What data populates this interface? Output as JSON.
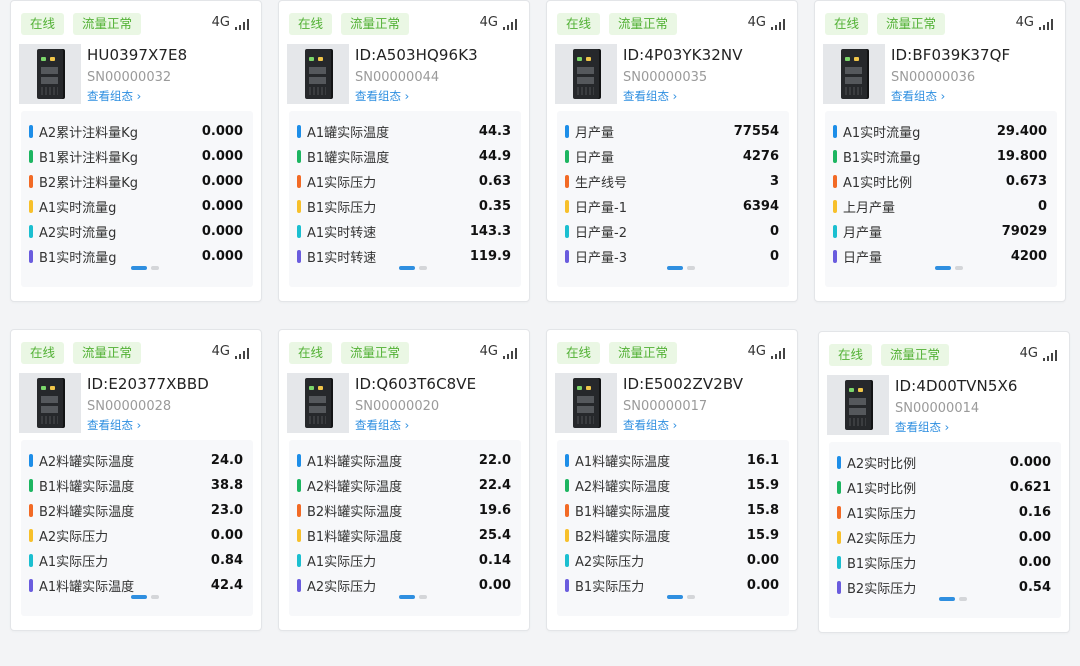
{
  "colors": {
    "bar_blue": "#1d8ee8",
    "bar_green": "#1db561",
    "bar_orange": "#f26a25",
    "bar_yellow": "#f7c02b",
    "bar_cyan": "#1bbfd0",
    "bar_purple": "#6a5cde",
    "tag_bg": "#eaf7e4",
    "tag_text": "#52b135",
    "link": "#2f8fe0"
  },
  "cards": [
    {
      "status": "在线",
      "flow": "流量正常",
      "network": "4G",
      "device_id": "HU0397X7E8",
      "serial": "SN00000032",
      "view_link": "查看组态 ›",
      "metrics": [
        {
          "label": "A2累计注料量Kg",
          "value": "0.000"
        },
        {
          "label": "B1累计注料量Kg",
          "value": "0.000"
        },
        {
          "label": "B2累计注料量Kg",
          "value": "0.000"
        },
        {
          "label": "A1实时流量g",
          "value": "0.000"
        },
        {
          "label": "A2实时流量g",
          "value": "0.000"
        },
        {
          "label": "B1实时流量g",
          "value": "0.000"
        }
      ]
    },
    {
      "status": "在线",
      "flow": "流量正常",
      "network": "4G",
      "device_id": "ID:A503HQ96K3",
      "serial": "SN00000044",
      "view_link": "查看组态 ›",
      "metrics": [
        {
          "label": "A1罐实际温度",
          "value": "44.3"
        },
        {
          "label": "B1罐实际温度",
          "value": "44.9"
        },
        {
          "label": "A1实际压力",
          "value": "0.63"
        },
        {
          "label": "B1实际压力",
          "value": "0.35"
        },
        {
          "label": "A1实时转速",
          "value": "143.3"
        },
        {
          "label": "B1实时转速",
          "value": "119.9"
        }
      ]
    },
    {
      "status": "在线",
      "flow": "流量正常",
      "network": "4G",
      "device_id": "ID:4P03YK32NV",
      "serial": "SN00000035",
      "view_link": "查看组态 ›",
      "metrics": [
        {
          "label": "月产量",
          "value": "77554"
        },
        {
          "label": "日产量",
          "value": "4276"
        },
        {
          "label": "生产线号",
          "value": "3"
        },
        {
          "label": "日产量-1",
          "value": "6394"
        },
        {
          "label": "日产量-2",
          "value": "0"
        },
        {
          "label": "日产量-3",
          "value": "0"
        }
      ]
    },
    {
      "status": "在线",
      "flow": "流量正常",
      "network": "4G",
      "device_id": "ID:BF039K37QF",
      "serial": "SN00000036",
      "view_link": "查看组态 ›",
      "metrics": [
        {
          "label": "A1实时流量g",
          "value": "29.400"
        },
        {
          "label": "B1实时流量g",
          "value": "19.800"
        },
        {
          "label": "A1实时比例",
          "value": "0.673"
        },
        {
          "label": "上月产量",
          "value": "0"
        },
        {
          "label": "月产量",
          "value": "79029"
        },
        {
          "label": "日产量",
          "value": "4200"
        }
      ]
    },
    {
      "status": "在线",
      "flow": "流量正常",
      "network": "4G",
      "device_id": "ID:E20377XBBD",
      "serial": "SN00000028",
      "view_link": "查看组态 ›",
      "metrics": [
        {
          "label": "A2料罐实际温度",
          "value": "24.0"
        },
        {
          "label": "B1料罐实际温度",
          "value": "38.8"
        },
        {
          "label": "B2料罐实际温度",
          "value": "23.0"
        },
        {
          "label": "A2实际压力",
          "value": "0.00"
        },
        {
          "label": "A1实际压力",
          "value": "0.84"
        },
        {
          "label": "A1料罐实际温度",
          "value": "42.4"
        }
      ]
    },
    {
      "status": "在线",
      "flow": "流量正常",
      "network": "4G",
      "device_id": "ID:Q603T6C8VE",
      "serial": "SN00000020",
      "view_link": "查看组态 ›",
      "metrics": [
        {
          "label": "A1料罐实际温度",
          "value": "22.0"
        },
        {
          "label": "A2料罐实际温度",
          "value": "22.4"
        },
        {
          "label": "B2料罐实际温度",
          "value": "19.6"
        },
        {
          "label": "B1料罐实际温度",
          "value": "25.4"
        },
        {
          "label": "A1实际压力",
          "value": "0.14"
        },
        {
          "label": "A2实际压力",
          "value": "0.00"
        }
      ]
    },
    {
      "status": "在线",
      "flow": "流量正常",
      "network": "4G",
      "device_id": "ID:E5002ZV2BV",
      "serial": "SN00000017",
      "view_link": "查看组态 ›",
      "metrics": [
        {
          "label": "A1料罐实际温度",
          "value": "16.1"
        },
        {
          "label": "A2料罐实际温度",
          "value": "15.9"
        },
        {
          "label": "B1料罐实际温度",
          "value": "15.8"
        },
        {
          "label": "B2料罐实际温度",
          "value": "15.9"
        },
        {
          "label": "A2实际压力",
          "value": "0.00"
        },
        {
          "label": "B1实际压力",
          "value": "0.00"
        }
      ]
    },
    {
      "status": "在线",
      "flow": "流量正常",
      "network": "4G",
      "device_id": "ID:4D00TVN5X6",
      "serial": "SN00000014",
      "view_link": "查看组态 ›",
      "metrics": [
        {
          "label": "A2实时比例",
          "value": "0.000"
        },
        {
          "label": "A1实时比例",
          "value": "0.621"
        },
        {
          "label": "A1实际压力",
          "value": "0.16"
        },
        {
          "label": "A2实际压力",
          "value": "0.00"
        },
        {
          "label": "B1实际压力",
          "value": "0.00"
        },
        {
          "label": "B2实际压力",
          "value": "0.54"
        }
      ]
    }
  ]
}
